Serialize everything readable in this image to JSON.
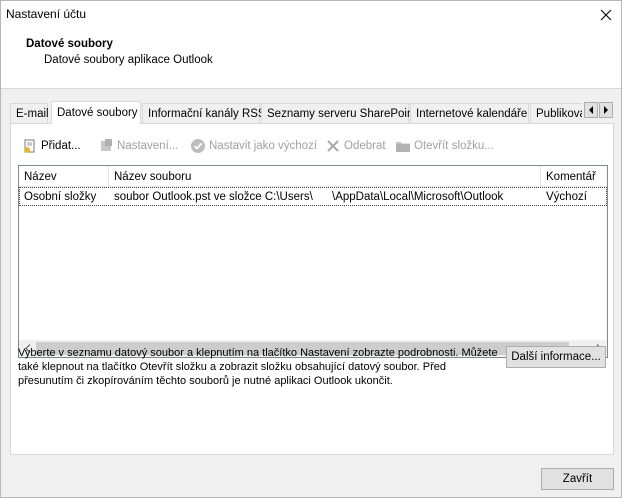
{
  "window": {
    "title": "Nastavení účtu"
  },
  "header": {
    "title": "Datové soubory",
    "subtitle": "Datové soubory aplikace Outlook"
  },
  "tabs": [
    {
      "label": "E-mail",
      "active": false
    },
    {
      "label": "Datové soubory",
      "active": true
    },
    {
      "label": "Informační kanály RSS",
      "active": false
    },
    {
      "label": "Seznamy serveru SharePoint",
      "active": false
    },
    {
      "label": "Internetové kalendáře",
      "active": false
    },
    {
      "label": "Publikovan",
      "active": false
    }
  ],
  "toolbar": {
    "add": "Přidat...",
    "settings": "Nastavení...",
    "set_default": "Nastavit jako výchozí",
    "remove": "Odebrat",
    "open_folder": "Otevřít složku..."
  },
  "list": {
    "columns": [
      "Název",
      "Název souboru",
      "Komentář"
    ],
    "rows": [
      {
        "name": "Osobní složky",
        "file": "soubor Outlook.pst ve složce C:\\Users\\",
        "file_tail": "\\AppData\\Local\\Microsoft\\Outlook",
        "comment": "Výchozí"
      }
    ]
  },
  "description": "Vyberte v seznamu datový soubor a klepnutím na tlačítko Nastavení zobrazte podrobnosti. Můžete také klepnout na tlačítko Otevřít složku a zobrazit složku obsahující datový soubor. Před přesunutím či zkopírováním těchto souborů je nutné aplikaci Outlook ukončit.",
  "buttons": {
    "more_info": "Další informace...",
    "close": "Zavřít"
  },
  "colors": {
    "border": "#d9d9d9",
    "button_bg": "#e1e1e1",
    "disabled_text": "#a0a0a0"
  }
}
